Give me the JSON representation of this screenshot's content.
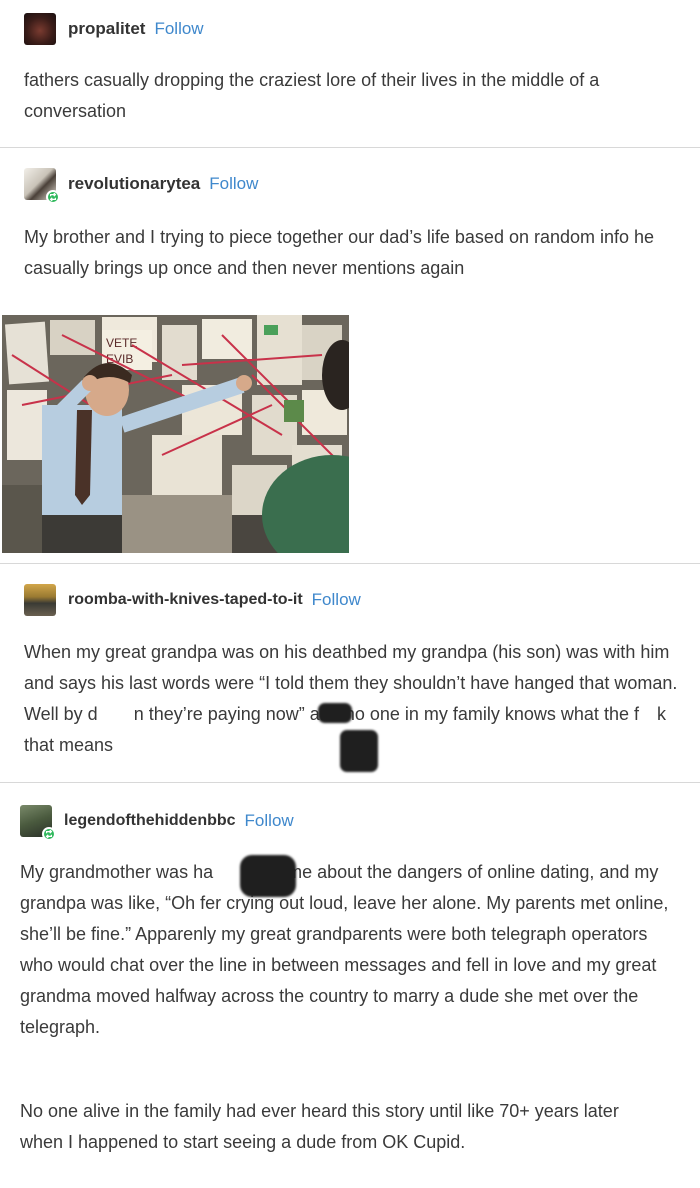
{
  "posts": [
    {
      "username": "propalitet",
      "follow_label": "Follow",
      "avatar_icon": "user-avatar",
      "text": "fathers casually dropping the craziest lore of their lives in the middle of a conversation"
    },
    {
      "username": "revolutionarytea",
      "follow_label": "Follow",
      "avatar_icon": "user-avatar",
      "reblog_icon": "reblog-icon",
      "text": "My brother and I trying to piece together our dad’s life based on random info he casually brings up once and then never mentions again",
      "image": {
        "description_icon": "conspiracy-board-meme-image",
        "board_sign": "VETE\nEVIB"
      }
    },
    {
      "username": "roomba-with-knives-taped-to-it",
      "follow_label": "Follow",
      "avatar_icon": "user-avatar",
      "text": "When my great grandpa was on his deathbed my grandpa (his son) was with him and says his last words were “I told them they shouldn’t have hanged that woman. Well by d  n they’re paying now” and no one in my family knows what the f  k that means"
    },
    {
      "username": "legendofthehiddenbbc",
      "follow_label": "Follow",
      "avatar_icon": "user-avatar",
      "reblog_icon": "reblog-icon",
      "paragraphs": [
        "My grandmother was ha  sing me about the dangers of online dating, and my grandpa was like, “Oh fer crying out loud, leave her alone. My parents met online, she’ll be fine.” Apparenly my great grandparents were both telegraph operators who would chat over the line in between messages and fell in love and my great grandma moved halfway across the country to marry a dude she met over the telegraph.",
        "No one alive in the family had ever heard this story until like 70+ years later when I happened to start seeing a dude from OK Cupid."
      ]
    }
  ],
  "colors": {
    "follow": "#3f88cc",
    "reblog_badge": "#2fb85c",
    "divider": "#d8d8d8",
    "text": "#3a3a3a"
  }
}
